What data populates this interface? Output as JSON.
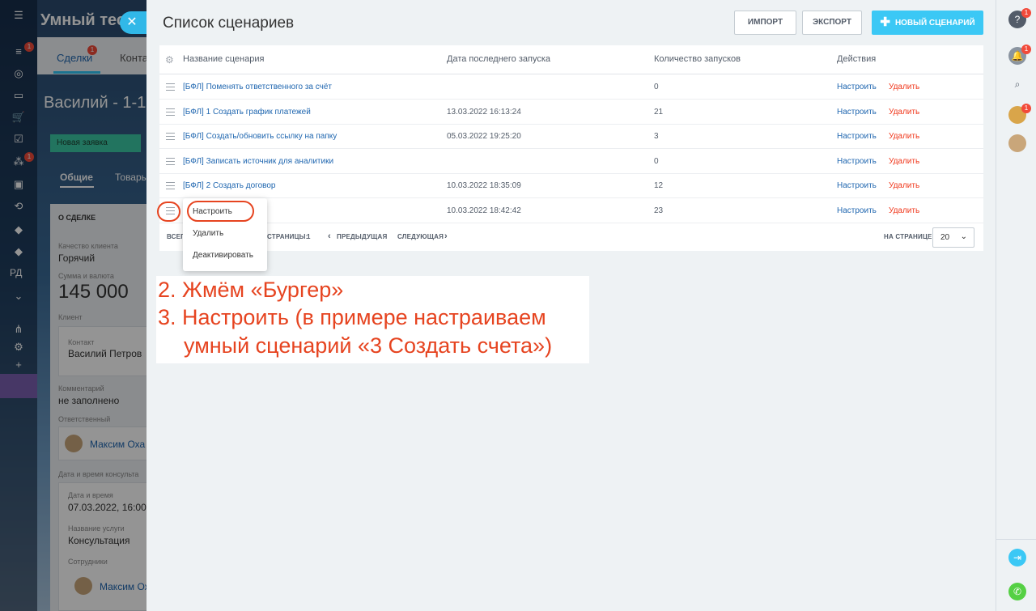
{
  "background": {
    "app_title": "Умный тест",
    "tabs": [
      "Сделки",
      "Конта"
    ],
    "deals_badge": "1",
    "deal_title": "Василий - 1-1,",
    "stage": "Новая заявка",
    "sub_tabs": [
      "Общие",
      "Товары"
    ],
    "card_header": "О СДЕЛКЕ",
    "quality_label": "Качество клиента",
    "quality_value": "Горячий",
    "amount_label": "Сумма и валюта",
    "amount_value": "145 000",
    "client_label": "Клиент",
    "contact_label": "Контакт",
    "contact_value": "Василий Петров",
    "comment_label": "Комментарий",
    "comment_value": "не заполнено",
    "responsible_label": "Ответственный",
    "responsible_value": "Максим Оха",
    "consult_label": "Дата и время консульта",
    "datetime_label": "Дата и время",
    "datetime_value": "07.03.2022, 16:00",
    "service_label": "Название услуги",
    "service_value": "Консультация",
    "staff_label": "Сотрудники",
    "staff_value": "Максим Ох",
    "sidebar_rd": "РД",
    "sidebar_badges": [
      "1",
      "1"
    ]
  },
  "panel": {
    "close_icon": "close-icon",
    "title": "Список сценариев",
    "import_label": "ИМПОРТ",
    "export_label": "ЭКСПОРТ",
    "new_label": "НОВЫЙ СЦЕНАРИЙ",
    "columns": [
      "Название сценария",
      "Дата последнего запуска",
      "Количество запусков",
      "Действия"
    ],
    "rows": [
      {
        "name": "[БФЛ] Поменять ответственного за счёт",
        "date": "",
        "count": "0",
        "configure": "Настроить",
        "delete": "Удалить"
      },
      {
        "name": "[БФЛ] 1 Создать график платежей",
        "date": "13.03.2022 16:13:24",
        "count": "21",
        "configure": "Настроить",
        "delete": "Удалить"
      },
      {
        "name": "[БФЛ] Создать/обновить ссылку на папку",
        "date": "05.03.2022 19:25:20",
        "count": "3",
        "configure": "Настроить",
        "delete": "Удалить"
      },
      {
        "name": "[БФЛ] Записать источник для аналитики",
        "date": "",
        "count": "0",
        "configure": "Настроить",
        "delete": "Удалить"
      },
      {
        "name": "[БФЛ] 2 Создать договор",
        "date": "10.03.2022 18:35:09",
        "count": "12",
        "configure": "Настроить",
        "delete": "Удалить"
      },
      {
        "name": "",
        "date": "10.03.2022 18:42:42",
        "count": "23",
        "configure": "Настроить",
        "delete": "Удалить"
      }
    ],
    "footer": {
      "total_label": "ВСЕГО",
      "pages_label": "СТРАНИЦЫ:",
      "page": "1",
      "prev_label": "ПРЕДЫДУЩАЯ",
      "next_label": "СЛЕДУЮЩАЯ",
      "per_page_label": "НА СТРАНИЦЕ:",
      "per_page_value": "20"
    }
  },
  "menu": {
    "items": [
      "Настроить",
      "Удалить",
      "Деактивировать"
    ]
  },
  "annotation": {
    "line1": "2. Жмём «Бургер»",
    "line2": "3. Настроить (в примере настраиваем",
    "line3": "умный сценарий «3 Создать счета»)"
  },
  "rightbar": {
    "badges": [
      "1",
      "1",
      "1"
    ]
  },
  "colors": {
    "accent": "#3bc8f5",
    "link": "#2067b0",
    "delete": "#f0371b",
    "annotation": "#e64420"
  }
}
